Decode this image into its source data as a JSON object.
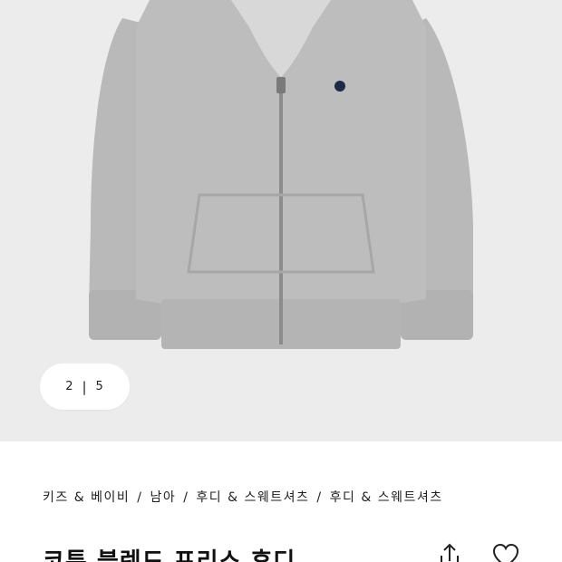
{
  "gallery": {
    "current_index": "2",
    "separator": "|",
    "total": "5",
    "image_label": "hoodie-product-image"
  },
  "breadcrumb": {
    "items": [
      "키즈 & 베이비",
      "남아",
      "후디 & 스웨트셔츠",
      "후디 & 스웨트셔츠"
    ],
    "separator": "/"
  },
  "product": {
    "title": "코튼 블렌드 프리스 후디"
  },
  "actions": {
    "share_icon": "share-icon",
    "wishlist_icon": "heart-icon"
  }
}
